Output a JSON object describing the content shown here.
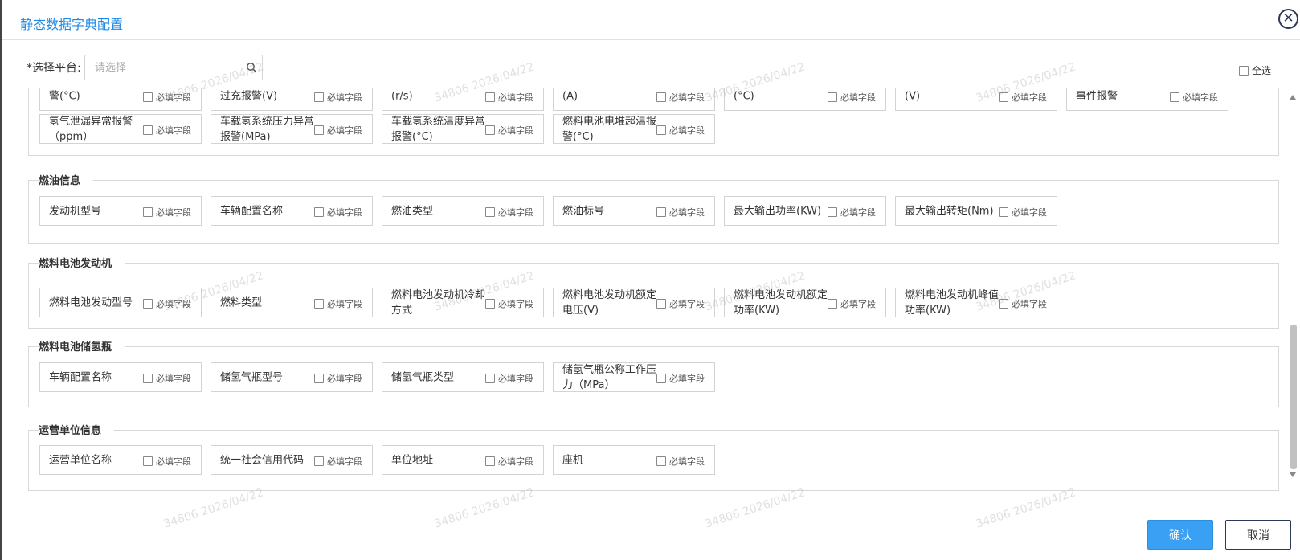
{
  "dialog": {
    "title": "静态数据字典配置",
    "close_glyph": "✕"
  },
  "platform": {
    "label": "*选择平台:",
    "placeholder": "请选择"
  },
  "select_all": {
    "label": "全选"
  },
  "required_label": "必填字段",
  "sections": [
    {
      "title": "",
      "fields": [
        {
          "label": "警(°C)"
        },
        {
          "label": "过充报警(V)"
        },
        {
          "label": "(r/s)"
        },
        {
          "label": "(A)"
        },
        {
          "label": "(°C)"
        },
        {
          "label": "(V)"
        },
        {
          "label": "事件报警"
        },
        {
          "label": "氢气泄漏异常报警（ppm）"
        },
        {
          "label": "车载氢系统压力异常报警(MPa)"
        },
        {
          "label": "车载氢系统温度异常报警(°C)"
        },
        {
          "label": "燃料电池电堆超温报警(°C)"
        }
      ]
    },
    {
      "title": "燃油信息",
      "fields": [
        {
          "label": "发动机型号"
        },
        {
          "label": "车辆配置名称"
        },
        {
          "label": "燃油类型"
        },
        {
          "label": "燃油标号"
        },
        {
          "label": "最大输出功率(KW)"
        },
        {
          "label": "最大输出转矩(Nm)"
        }
      ]
    },
    {
      "title": "燃料电池发动机",
      "fields": [
        {
          "label": "燃料电池发动型号"
        },
        {
          "label": "燃料类型"
        },
        {
          "label": "燃料电池发动机冷却方式"
        },
        {
          "label": "燃料电池发动机额定电压(V)"
        },
        {
          "label": "燃料电池发动机额定功率(KW)"
        },
        {
          "label": "燃料电池发动机峰值功率(KW)"
        }
      ]
    },
    {
      "title": "燃料电池储氢瓶",
      "fields": [
        {
          "label": "车辆配置名称"
        },
        {
          "label": "储氢气瓶型号"
        },
        {
          "label": "储氢气瓶类型"
        },
        {
          "label": "储氢气瓶公称工作压力（MPa）"
        }
      ]
    },
    {
      "title": "运营单位信息",
      "fields": [
        {
          "label": "运营单位名称"
        },
        {
          "label": "统一社会信用代码"
        },
        {
          "label": "单位地址"
        },
        {
          "label": "座机"
        }
      ]
    }
  ],
  "footer": {
    "confirm_label": "确认",
    "cancel_label": "取消"
  },
  "watermark": "34806 2026/04/22",
  "colors": {
    "accent": "#1e88e5",
    "confirm_bg": "#3aa0f3"
  }
}
